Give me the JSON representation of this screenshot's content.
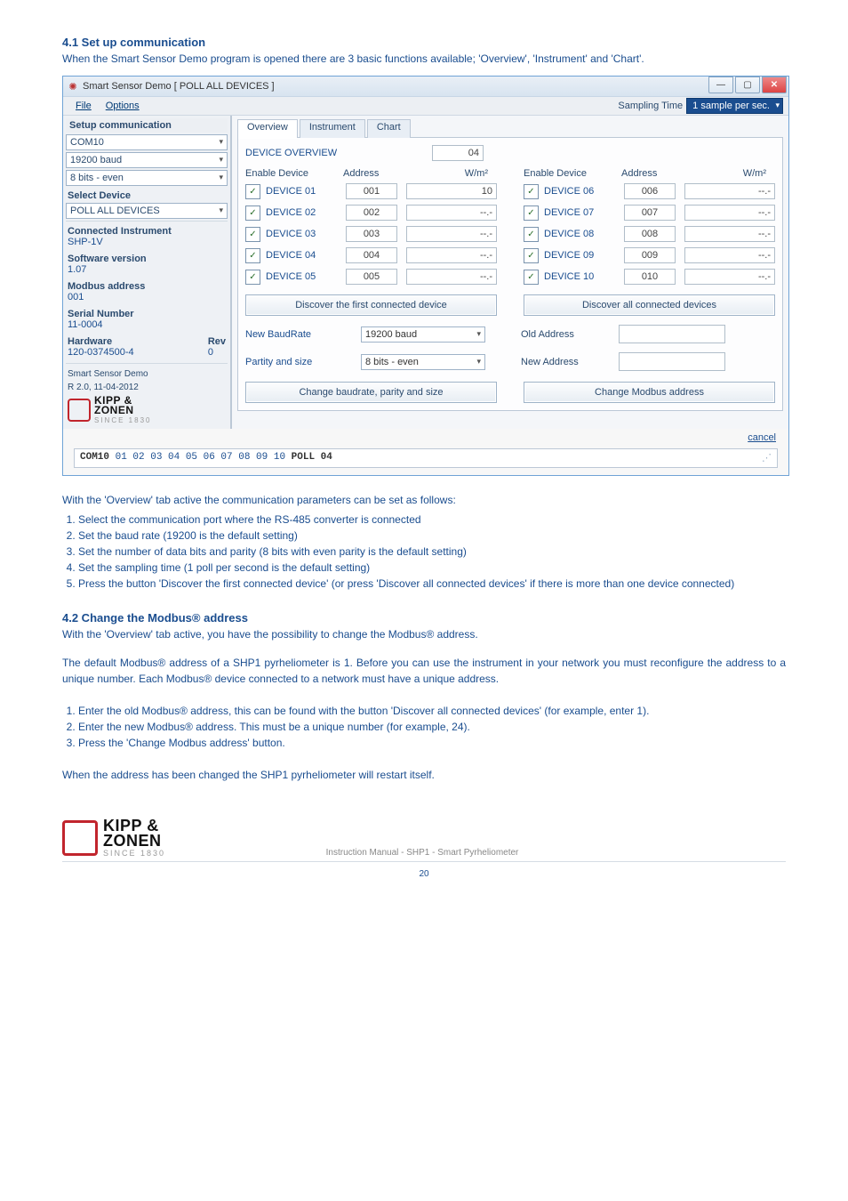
{
  "section41": {
    "title": "4.1 Set up communication",
    "intro": "When the Smart Sensor Demo program is opened there are 3 basic functions available; 'Overview', 'Instrument' and 'Chart'."
  },
  "window": {
    "title": "Smart Sensor Demo [ POLL ALL DEVICES ]",
    "menu_file": "File",
    "menu_options": "Options",
    "sampling_label": "Sampling Time",
    "sampling_value": "1 sample per sec.",
    "sidebar": {
      "setup_label": "Setup communication",
      "com_port": "COM10",
      "baud": "19200 baud",
      "bits": "8 bits - even",
      "select_device": "Select Device",
      "poll_all": "POLL ALL DEVICES",
      "connected_instrument_label": "Connected Instrument",
      "connected_instrument_value": "SHP-1V",
      "software_version_label": "Software version",
      "software_version_value": "1.07",
      "modbus_label": "Modbus address",
      "modbus_value": "001",
      "serial_label": "Serial Number",
      "serial_value": "11-0004",
      "hardware_label": "Hardware",
      "hardware_value": "120-0374500-4",
      "rev_label": "Rev",
      "rev_value": "0",
      "demo_name": "Smart Sensor Demo",
      "demo_rev": "R 2.0, 11-04-2012",
      "logo_line1": "KIPP &",
      "logo_line2": "ZONEN",
      "logo_since": "SINCE 1830"
    },
    "tabs": {
      "overview": "Overview",
      "instrument": "Instrument",
      "chart": "Chart"
    },
    "overview": {
      "heading": "DEVICE OVERVIEW",
      "count": "04",
      "col_enable": "Enable Device",
      "col_address": "Address",
      "col_wm2": "W/m²",
      "left": [
        {
          "name": "DEVICE 01",
          "addr": "001",
          "val": "10"
        },
        {
          "name": "DEVICE 02",
          "addr": "002",
          "val": "--.-"
        },
        {
          "name": "DEVICE 03",
          "addr": "003",
          "val": "--.-"
        },
        {
          "name": "DEVICE 04",
          "addr": "004",
          "val": "--.-"
        },
        {
          "name": "DEVICE 05",
          "addr": "005",
          "val": "--.-"
        }
      ],
      "right": [
        {
          "name": "DEVICE 06",
          "addr": "006",
          "val": "--.-"
        },
        {
          "name": "DEVICE 07",
          "addr": "007",
          "val": "--.-"
        },
        {
          "name": "DEVICE 08",
          "addr": "008",
          "val": "--.-"
        },
        {
          "name": "DEVICE 09",
          "addr": "009",
          "val": "--.-"
        },
        {
          "name": "DEVICE 10",
          "addr": "010",
          "val": "--.-"
        }
      ],
      "discover_first": "Discover the first connected device",
      "discover_all": "Discover all connected devices",
      "new_baud_label": "New BaudRate",
      "new_baud_value": "19200 baud",
      "parity_label": "Partity and size",
      "parity_value": "8 bits - even",
      "old_addr_label": "Old Address",
      "new_addr_label": "New Address",
      "change_baud_btn": "Change baudrate, parity and size",
      "change_addr_btn": "Change Modbus address"
    },
    "cancel": "cancel",
    "status_prefix": "COM10 ",
    "status_nums": "01 02 03 04 05 06 07 08 09 10",
    "status_suffix": " POLL 04"
  },
  "overview_paragraph": "With the 'Overview' tab active the communication parameters can be set as follows:",
  "overview_steps": [
    "Select the communication port where the RS-485 converter is connected",
    "Set the baud rate (19200 is the default setting)",
    "Set the number of data bits and parity (8 bits with even parity is the default setting)",
    "Set the sampling time (1 poll per second is the default setting)",
    "Press the button 'Discover the first connected device' (or press 'Discover all connected devices' if there is more than one device connected)"
  ],
  "section42": {
    "title": "4.2 Change the Modbus® address",
    "p1": "With the 'Overview' tab active, you have the possibility to change the Modbus® address.",
    "p2": "The default Modbus® address of a SHP1 pyrheliometer is 1. Before you can use the instrument in your network you must reconfigure the address to a unique number. Each Modbus® device connected to a network must have a unique address.",
    "steps": [
      "Enter the old Modbus® address, this can be found with the button 'Discover all connected devices' (for example, enter 1).",
      "Enter the new Modbus® address. This must be a unique number (for example, 24).",
      "Press the 'Change Modbus address' button."
    ],
    "p3": "When the address has been changed the SHP1 pyrheliometer will restart itself."
  },
  "footer": {
    "logo_line1": "KIPP &",
    "logo_line2": "ZONEN",
    "logo_since": "SINCE 1830",
    "doc_title": "Instruction Manual - SHP1 - Smart Pyrheliometer",
    "page_num": "20"
  }
}
